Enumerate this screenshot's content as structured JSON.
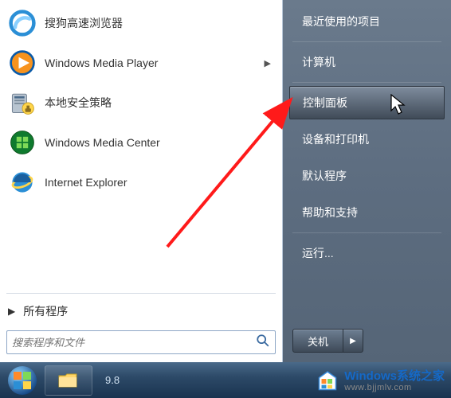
{
  "left_programs": [
    {
      "label": "搜狗高速浏览器",
      "icon": "sogou",
      "has_submenu": false
    },
    {
      "label": "Windows Media Player",
      "icon": "wmp",
      "has_submenu": true
    },
    {
      "label": "本地安全策略",
      "icon": "secpol",
      "has_submenu": false
    },
    {
      "label": "Windows Media Center",
      "icon": "wmc",
      "has_submenu": false
    },
    {
      "label": "Internet Explorer",
      "icon": "ie",
      "has_submenu": false
    }
  ],
  "all_programs_label": "所有程序",
  "search_placeholder": "搜索程序和文件",
  "right_items": [
    {
      "label": "最近使用的项目",
      "highlight": false,
      "submenu": true
    },
    {
      "label": "计算机",
      "highlight": false
    },
    {
      "label": "控制面板",
      "highlight": true
    },
    {
      "label": "设备和打印机",
      "highlight": false
    },
    {
      "label": "默认程序",
      "highlight": false
    },
    {
      "label": "帮助和支持",
      "highlight": false
    },
    {
      "label": "运行...",
      "highlight": false
    }
  ],
  "shutdown_label": "关机",
  "taskbar_version": "9.8",
  "watermark": {
    "title": "Windows系统之家",
    "url": "www.bjjmlv.com"
  }
}
